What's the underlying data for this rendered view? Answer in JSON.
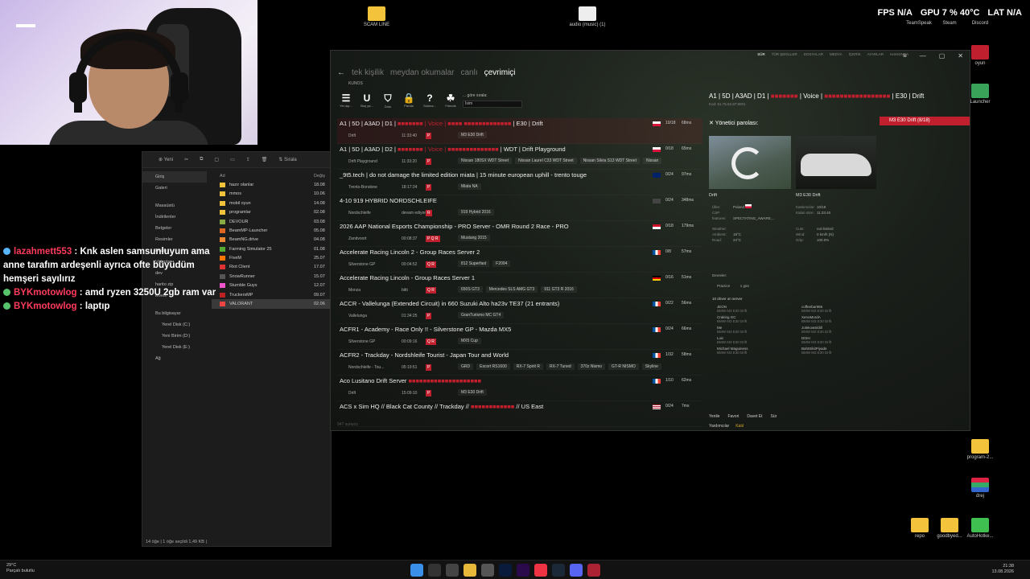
{
  "tray": {
    "fps_label": "FPS",
    "fps_value": "N/A",
    "gpu_label": "GPU",
    "gpu_value": "7 %",
    "gpu_temp": "40°C",
    "lat_label": "LAT",
    "lat_value": "N/A"
  },
  "desktop_icons": [
    {
      "label": "SCAM LINE"
    },
    {
      "label": "audio (music) (1)"
    },
    {
      "label": "TeamSpeak"
    },
    {
      "label": "Steam"
    },
    {
      "label": "Discord"
    },
    {
      "label": "oyun"
    },
    {
      "label": "Launcher"
    },
    {
      "label": "program-2..."
    },
    {
      "label": "drej"
    },
    {
      "label": "repo"
    },
    {
      "label": "goodbyed..."
    },
    {
      "label": "AutoHotke..."
    }
  ],
  "chat": [
    {
      "user": "lazahmett553",
      "message": "Knk aslen samsunluyum ama anne tarafım ardeşenli ayrıca ofte büyüdüm hemşeri sayılırız"
    },
    {
      "user": "BYKmotowlog",
      "message": "amd ryzen 3250U 2gb ram var"
    },
    {
      "user": "BYKmotowlog",
      "message": "laptıp"
    }
  ],
  "explorer": {
    "new_label": "Yeni",
    "sort_label": "Sırala",
    "nav": [
      "Giriş",
      "Galeri",
      "Masaüstü",
      "İndirilenler",
      "Belgeler",
      "Resimler",
      "Müzik",
      "Videolar",
      "dev",
      "harito zip",
      "levels",
      "Bu bilgisayar",
      "Yerel Disk (C:)",
      "Yeni Birim (D:)",
      "Yerel Disk (E:)",
      "Ağ"
    ],
    "column_name": "Ad",
    "column_date": "Değiş",
    "files": [
      "hazır olanlar",
      "mmos",
      "mobil oyun",
      "programlar",
      "DEVOUR",
      "BeamMP-Launcher",
      "BeamNG.drive",
      "Farming Simulator 25",
      "FiveM",
      "Riot Client",
      "SnowRunner",
      "Stumble Guys",
      "TruckersMP",
      "VALORANT"
    ],
    "dates": [
      "18.08",
      "10.06",
      "14.08",
      "02.08",
      "03.08",
      "05.08",
      "04.08",
      "01.08",
      "25.07",
      "17.07",
      "15.07",
      "12.07",
      "09.07",
      "02.06"
    ],
    "status": "14 öğe   |   1 öğe seçildi  1,49 KB  |"
  },
  "cm": {
    "menu": [
      "SÜR",
      "TÜR ŞEKİLLER",
      "DOSYALAR",
      "MEDYA",
      "İÇERİK",
      "AYARLAR",
      "HAKKINDA"
    ],
    "tabs": [
      "tek kişilik",
      "meydan okumalar",
      "canlı",
      "çevrimiçi"
    ],
    "kunos": "KUNOS",
    "filters": [
      {
        "icon": "☰",
        "label": "Yer aşı..."
      },
      {
        "icon": "U",
        "label": "Boş ya..."
      },
      {
        "icon": "⛉",
        "label": "Dolu"
      },
      {
        "icon": "🔒",
        "label": "Parola"
      },
      {
        "icon": "?",
        "label": "Soluna..."
      },
      {
        "icon": "☘",
        "label": "Friends"
      }
    ],
    "sort_label": "... göre sırala:",
    "sort_value": "İsim",
    "server_count": "947 sunucu",
    "servers": [
      {
        "name_a": "A1 | 5D | A3AD | D1 | ",
        "name_red": "■■■■■■■ | Voice | ■■■■ ■■■■■■■■■■■■■",
        "name_b": " | E30 | Drift",
        "track": "Drift",
        "time": "11:33:40",
        "pill": "P",
        "cars": [
          "M3 E30 Drift"
        ],
        "flag": "pl",
        "players": "10/18",
        "ping": "68ms",
        "hl": true
      },
      {
        "name_a": "A1 | 5D | A3AD | D2 | ",
        "name_red": "■■■■■■■ | Voice | ■■■■■■■■■■■■■■",
        "name_b": " | WDT | Drift Playground",
        "track": "Drift Playground",
        "time": "11:33:20",
        "pill": "P",
        "cars": [
          "Nissan 180SX WDT Street",
          "Nissan Laurel C33 WDT Street",
          "Nissan Silvia S13 WDT Street",
          "Nissan"
        ],
        "flag": "pl",
        "players": "0/18",
        "ping": "65ms",
        "hl": false
      },
      {
        "name_a": "_9t5.tech | do not damage the limited edition miata | 15 minute european uphill - trento touge",
        "name_red": "",
        "name_b": "",
        "track": "Trento-Bondone",
        "time": "18:17:24",
        "pill": "P",
        "cars": [
          "Miata NA"
        ],
        "flag": "uk",
        "players": "0/24",
        "ping": "97ms",
        "hl": false
      },
      {
        "name_a": "4-10 919 HYBRID NORDSCHLEIFE",
        "name_red": "",
        "name_b": "",
        "track": "Nordschleife",
        "time": "devam ediyor",
        "pill": "R",
        "cars": [
          "919 Hybrid 2016"
        ],
        "flag": "none",
        "players": "0/24",
        "ping": "348ms",
        "hl": false
      },
      {
        "name_a": "2026 AAP National Esports Championship - PRO Server - OMR Round 2 Race - PRO",
        "name_red": "",
        "name_b": "",
        "track": "Zandvoort",
        "time": "00:08:37",
        "pill": "P Q R",
        "cars": [
          "Mustang 2015"
        ],
        "flag": "id",
        "players": "0/18",
        "ping": "179ms",
        "hl": false
      },
      {
        "name_a": "Accelerate Racing Lincoln 2 - Group Races Server 2",
        "name_red": "",
        "name_b": "",
        "track": "Silverstone GP",
        "time": "00:04:52",
        "pill": "Q R",
        "cars": [
          "812 Superfast",
          "F2004"
        ],
        "flag": "fr",
        "players": "0/8",
        "ping": "57ms",
        "hl": false
      },
      {
        "name_a": "Accelerate Racing Lincoln - Group Races Server 1",
        "name_red": "",
        "name_b": "",
        "track": "Monza",
        "time": "bitti",
        "pill": "Q R",
        "cars": [
          "650S GT3",
          "Mercedes SLS AMG GT3",
          "911 GT3 R 2016"
        ],
        "flag": "de",
        "players": "0/16",
        "ping": "51ms",
        "hl": false
      },
      {
        "name_a": "ACCR - Vallelunga (Extended Circuit) in 660 Suzuki Alto ha23v TE37 (21 entrants)",
        "name_red": "",
        "name_b": "",
        "track": "Vallelunga",
        "time": "01:34:25",
        "pill": "P",
        "cars": [
          "GranTurismo MC GT4"
        ],
        "flag": "fr",
        "players": "0/22",
        "ping": "56ms",
        "hl": false
      },
      {
        "name_a": "ACFR1 - Academy - Race Only !! - Silverstone GP - Mazda MX5",
        "name_red": "",
        "name_b": "",
        "track": "Silverstone GP",
        "time": "00:09:16",
        "pill": "Q R",
        "cars": [
          "MX5 Cup"
        ],
        "flag": "fr",
        "players": "0/24",
        "ping": "66ms",
        "hl": false
      },
      {
        "name_a": "ACFR2 - Trackday - Nordshleife Tourist - Japan Tour and World",
        "name_red": "",
        "name_b": "",
        "track": "Nordschleife - Tou...",
        "time": "05:19:51",
        "pill": "P",
        "cars": [
          "GRD",
          "Escort RS1600",
          "RX-7 Spirit R",
          "RX-7 Tuned",
          "370z Nismo",
          "GT-R NISMO",
          "Skyline"
        ],
        "flag": "fr",
        "players": "1/32",
        "ping": "58ms",
        "hl": false
      },
      {
        "name_a": "Aco Lusitano Drift Server ",
        "name_red": "■■■■■■■■■■■■■■■■■■■■",
        "name_b": "",
        "track": "Drift",
        "time": "15:09:10",
        "pill": "P",
        "cars": [
          "M3 E30 Drift"
        ],
        "flag": "fr",
        "players": "1/10",
        "ping": "62ms",
        "hl": false
      },
      {
        "name_a": "ACS x Sim HQ // Black Cat County // Trackday // ",
        "name_red": "■■■■■■■■■■■■",
        "name_b": " // US East",
        "track": "",
        "time": "",
        "pill": "",
        "cars": [],
        "flag": "us",
        "players": "0/24",
        "ping": "7ms",
        "hl": false
      }
    ]
  },
  "detail": {
    "title_a": "A1 | 5D | A3AD | D1 | ",
    "title_red": "■■■■■■■ ",
    "title_b": "| Voice | ",
    "title_red2": "■■■■■■■■■■■■■■■■■ ",
    "title_c": "| E30 | Drift",
    "sub": "Kod: 51.75.52.87:8001",
    "car_badge": "M3 E30 Drift (8/18)",
    "admin_pw": "Yönetici parolası:",
    "track_label": "Drift",
    "car_label": "M3 E30 Drift",
    "country_label": "Ülke:",
    "country_value": "Poland",
    "csp_label": "CSP features:",
    "csp_value": "SPECTATING_AWARE,...",
    "slots_label": "Katılımcılar:",
    "slots_value": "10/18",
    "remaining_label": "Kalan süre:",
    "remaining_value": "11:33:40",
    "weather_label": "Weather:",
    "ambient_label": "Ambient:",
    "ambient_value": "18°C",
    "road_label": "Road:",
    "road_value": "24°C",
    "cuts_label": "Cuts:",
    "cuts_value": "not limited",
    "wind_label": "Wind:",
    "wind_value": "0 km/h (N)",
    "grip_label": "Grip:",
    "grip_value": "100.0%",
    "sessions_label": "Devreler:",
    "practice_label": "Practice",
    "practice_value": "1 gün",
    "drivers_label": "10 driver on server",
    "drivers": [
      {
        "name": "JEON",
        "car": "BMW M3 E30 Drift"
      },
      {
        "name": "coffeebar966",
        "car": "BMW M3 E30 Drift"
      },
      {
        "name": "Craking GC",
        "car": "BMW M3 E30 Drift"
      },
      {
        "name": "XenoMordA",
        "car": "BMW M3 E30 Drift"
      },
      {
        "name": "Me",
        "car": "BMW M3 E30 Drift"
      },
      {
        "name": "Jolekowskilill",
        "car": "BMW M3 E30 Drift"
      },
      {
        "name": "Loic",
        "car": "BMW M3 E30 Drift"
      },
      {
        "name": "DISH",
        "car": "BMW M3 E30 Drift"
      },
      {
        "name": "Michael Maguiness",
        "car": "BMW M3 E30 Drift"
      },
      {
        "name": "BahtSikitPiyade",
        "car": "BMW M3 E30 Drift"
      }
    ],
    "btn_refresh": "Yenile",
    "btn_fav": "Favori",
    "btn_invite": "Davet Et",
    "btn_drive": "Sür",
    "btn_help": "Yardımcılar",
    "btn_join": "Katıl"
  },
  "taskbar": {
    "temp": "29°C",
    "weather": "Parçalı bulutlu",
    "time": "21:38",
    "date": "13.08.2026"
  }
}
